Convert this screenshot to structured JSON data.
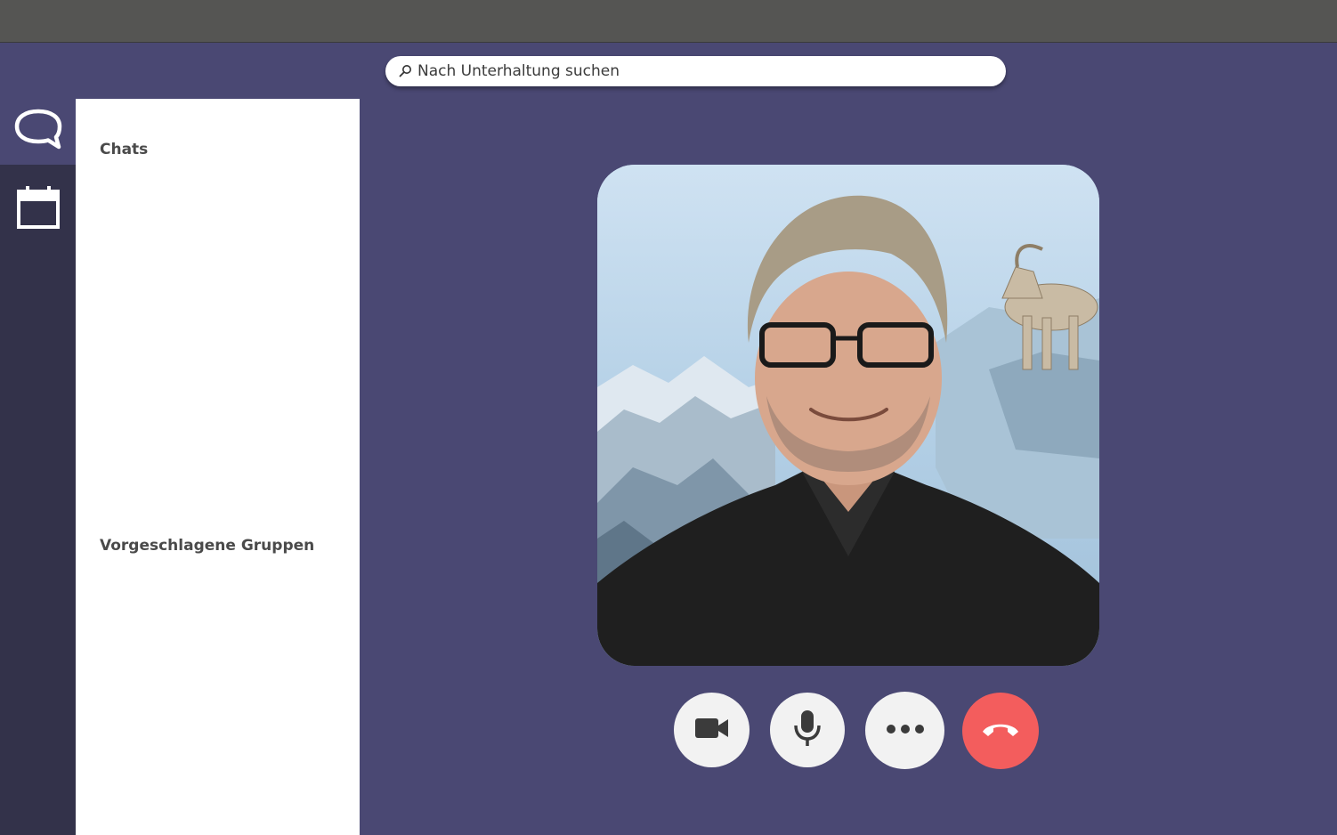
{
  "search": {
    "placeholder": "Nach Unterhaltung suchen",
    "icon": "search-icon"
  },
  "rail": {
    "items": [
      {
        "name": "chat",
        "icon": "chat-bubble-icon",
        "active": true
      },
      {
        "name": "calendar",
        "icon": "calendar-icon",
        "active": false
      }
    ]
  },
  "panel": {
    "chats_heading": "Chats",
    "groups_heading": "Vorgeschlagene Gruppen"
  },
  "call": {
    "participant_image": "participant-video-feed",
    "controls": [
      {
        "name": "camera",
        "icon": "video-camera-icon"
      },
      {
        "name": "microphone",
        "icon": "microphone-icon"
      },
      {
        "name": "more",
        "icon": "more-dots-icon"
      },
      {
        "name": "hang-up",
        "icon": "hang-up-phone-icon"
      }
    ]
  },
  "colors": {
    "titlebar": "#555553",
    "app_bg": "#4a4873",
    "rail_bg": "#33324a",
    "panel_bg": "#ffffff",
    "button_bg": "#f2f2f2",
    "hangup": "#f35d5d"
  }
}
